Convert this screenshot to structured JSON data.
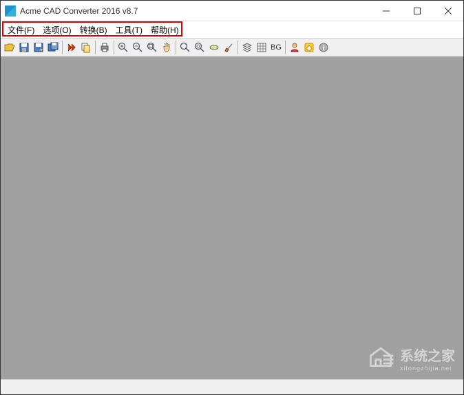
{
  "titlebar": {
    "title": "Acme CAD Converter 2016 v8.7"
  },
  "menubar": {
    "items": [
      {
        "label": "文件(F)",
        "key": "F"
      },
      {
        "label": "选项(O)",
        "key": "O"
      },
      {
        "label": "转换(B)",
        "key": "B"
      },
      {
        "label": "工具(T)",
        "key": "T"
      },
      {
        "label": "帮助(H)",
        "key": "H"
      }
    ]
  },
  "toolbar": {
    "bg_label": "BG",
    "icons": {
      "open": "open",
      "save": "save",
      "saveas": "saveas",
      "savefloppy": "savefloppy",
      "run": "run",
      "copy": "copy",
      "print": "print",
      "zoomin": "zoomin",
      "zoomout": "zoomout",
      "zoomwin": "zoomwin",
      "pan": "pan",
      "zoomext": "zoomext",
      "zoomall": "zoomall",
      "cloud": "cloud",
      "brush": "brush",
      "layers": "layers",
      "grid": "grid",
      "user": "user",
      "home": "home",
      "info": "info"
    }
  },
  "watermark": {
    "main": "系统之家",
    "sub": "xitongzhijia.net"
  }
}
